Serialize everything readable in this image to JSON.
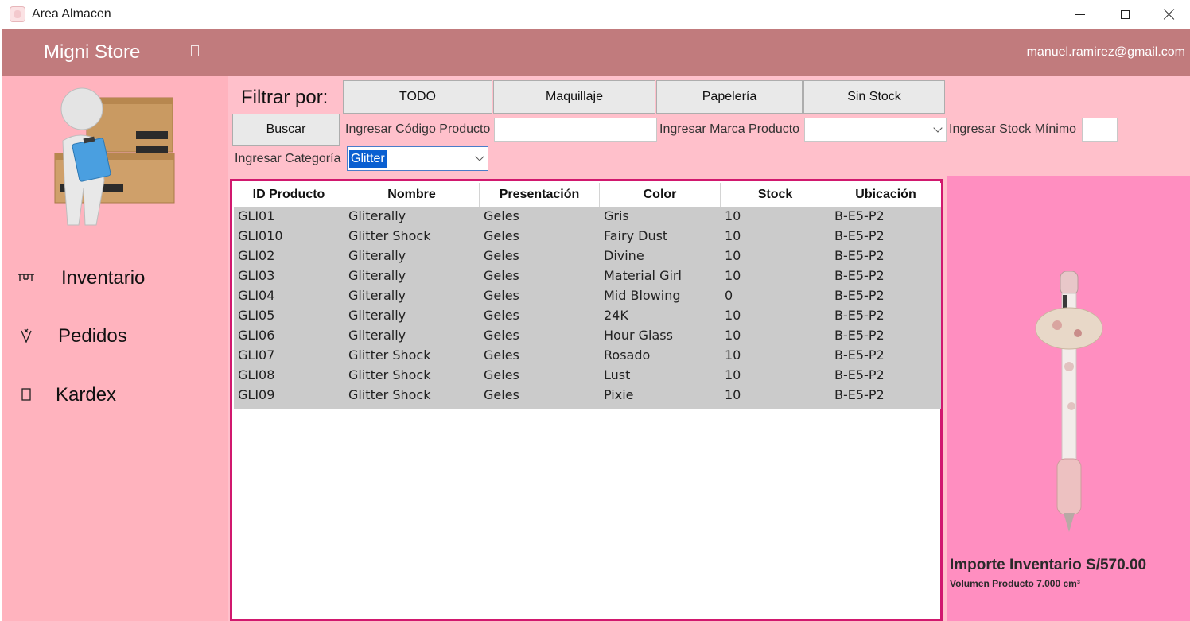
{
  "window": {
    "title": "Area Almacen"
  },
  "header": {
    "brand": "Migni Store",
    "user_email": "manuel.ramirez@gmail.com"
  },
  "sidebar": {
    "items": [
      {
        "label": "Inventario",
        "icon": "inventory-icon"
      },
      {
        "label": "Pedidos",
        "icon": "orders-icon"
      },
      {
        "label": "Kardex",
        "icon": "kardex-icon"
      }
    ]
  },
  "filters": {
    "label": "Filtrar por:",
    "buttons": {
      "todo": "TODO",
      "maquillaje": "Maquillaje",
      "papeleria": "Papelería",
      "sin_stock": "Sin Stock"
    },
    "search_button": "Buscar",
    "codigo_label": "Ingresar Código Producto",
    "codigo_value": "",
    "marca_label": "Ingresar Marca Producto",
    "marca_value": "",
    "stock_label": "Ingresar Stock Mínimo",
    "stock_value": "",
    "categoria_label": "Ingresar Categoría",
    "categoria_value": "Glitter"
  },
  "table": {
    "columns": [
      "ID Producto",
      "Nombre",
      "Presentación",
      "Color",
      "Stock",
      "Ubicación"
    ],
    "rows": [
      [
        "GLI01",
        "Gliterally",
        "Geles",
        "Gris",
        "10",
        "B-E5-P2"
      ],
      [
        "GLI010",
        "Glitter Shock",
        "Geles",
        "Fairy Dust",
        "10",
        "B-E5-P2"
      ],
      [
        "GLI02",
        "Gliterally",
        "Geles",
        "Divine",
        "10",
        "B-E5-P2"
      ],
      [
        "GLI03",
        "Gliterally",
        "Geles",
        "Material Girl",
        "10",
        "B-E5-P2"
      ],
      [
        "GLI04",
        "Gliterally",
        "Geles",
        "Mid Blowing",
        "0",
        "B-E5-P2"
      ],
      [
        "GLI05",
        "Gliterally",
        "Geles",
        "24K",
        "10",
        "B-E5-P2"
      ],
      [
        "GLI06",
        "Gliterally",
        "Geles",
        "Hour Glass",
        "10",
        "B-E5-P2"
      ],
      [
        "GLI07",
        "Glitter Shock",
        "Geles",
        "Rosado",
        "10",
        "B-E5-P2"
      ],
      [
        "GLI08",
        "Glitter Shock",
        "Geles",
        "Lust",
        "10",
        "B-E5-P2"
      ],
      [
        "GLI09",
        "Glitter Shock",
        "Geles",
        "Pixie",
        "10",
        "B-E5-P2"
      ]
    ]
  },
  "product_panel": {
    "importe": "Importe Inventario S/570.00",
    "volumen": "Volumen Producto 7.000 cm³"
  },
  "colors": {
    "header": "#c17b7d",
    "sidebar": "#ffb3be",
    "main": "#ffc0cb",
    "table_border": "#d1186e",
    "right_panel": "#ff8ec0"
  }
}
